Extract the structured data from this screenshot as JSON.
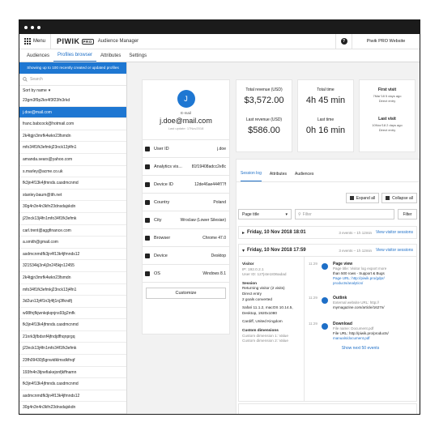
{
  "app": {
    "menu_label": "Menu",
    "logo": "PIWIK",
    "logo_badge": "PRO",
    "app_name": "Audience Manager",
    "website": "Piwik PRO Website"
  },
  "nav": {
    "tabs": [
      "Audiences",
      "Profiles browser",
      "Attributes",
      "Settings"
    ],
    "active": 1
  },
  "sidebar": {
    "banner": "Showing up to 100 recently created or updated profiles",
    "search_placeholder": "Search",
    "sort_label": "Sort by name",
    "items": [
      "23gm3f9p2kn4f3f23fn3rkd",
      "j.doe@mail.com",
      "franc.babcock@hotmail.com",
      "2k4tgjn3mrfk4wkn23fsmdn",
      "mfo34f1fk3efmkj23nck13j4fn1",
      "amanda.sears@yahoo.com",
      "s.marley@acme.co.uk",
      "fk3jn4f13k4jfmnds.casdmcnmd",
      "stanley.baum@tth.net",
      "30g4n3n4n3kfn23dnsdajskdn",
      "j23nck13j4fn1mfo34f1fk3efmk",
      "carl.trent@aggfinance.com",
      "a.smith@gmail.com",
      "asdmcnmdfk3jn4f13k4jfmnds12",
      "321534kj3n4j3n245kjn12455",
      "2k4tgjn3mrfk4wkn23fsmdn",
      "mfo34f1fk3efmkj23nck13j4fn1",
      "3d2un13j4f1n3j4fj1nj3fkndfj",
      "w98fnjfkjwnkqkqnjns93g2mfk",
      "fk3jn4f13k4jfmnds.casdmcnmd",
      "21nrk3jfbdsnf4jfndjdfhqnprgq",
      "j23nck13j4fn1mfo34f1fk3efmk",
      "23fh09430j5gnwidklmsdkfnqf",
      "193fn4n3tjnefiakejonfjkffnamn",
      "fk3jn4f13k4jfmnds.casdmcnmd",
      "asdmcnmdfk3jn4f13k4jfmnds12",
      "30g4n3n4n3kfn23dnsdajskdn"
    ],
    "selected": 1
  },
  "profile": {
    "avatar_letter": "J",
    "email_label": "E-mail",
    "email": "j.doe@mail.com",
    "last_update": "Last update: 17Nov2018",
    "attributes": [
      {
        "key": "User ID",
        "value": "j.doe",
        "icon": "user-id-icon"
      },
      {
        "key": "Analytics vis...",
        "value": "81f19408adcc2e8c",
        "icon": "analytics-icon"
      },
      {
        "key": "Device ID",
        "value": "12de46ae444f77f",
        "icon": "device-id-icon"
      },
      {
        "key": "Country",
        "value": "Poland",
        "icon": "flag-icon"
      },
      {
        "key": "City",
        "value": "Wroclaw (Lower Silesian)",
        "icon": "building-icon"
      },
      {
        "key": "Browser",
        "value": "Chrome 47.0",
        "icon": "browser-icon"
      },
      {
        "key": "Device",
        "value": "Desktop",
        "icon": "desktop-icon"
      },
      {
        "key": "OS",
        "value": "Windows 8.1",
        "icon": "os-icon"
      }
    ],
    "customize": "Customize"
  },
  "stats": {
    "revenue": {
      "top_label": "Total revenue (USD)",
      "top_value": "$3,572.00",
      "bottom_label": "Last revenue (USD)",
      "bottom_value": "$586.00"
    },
    "time": {
      "top_label": "Total time",
      "top_value": "4h 45 min",
      "bottom_label": "Last time",
      "bottom_value": "0h 16 min"
    },
    "visits": {
      "top_label": "First visit",
      "top_date": "7Mar'18 5 days ago",
      "top_source": "Direct entry",
      "bottom_label": "Last visit",
      "bottom_date": "10Nov'18 2 days ago",
      "bottom_source": "Direct entry"
    }
  },
  "sessions": {
    "tabs": [
      "Session log",
      "Attributes",
      "Audiences"
    ],
    "expand": "Expand all",
    "collapse": "Collapse all",
    "select": "Page title",
    "filter_placeholder": "Filter",
    "filter_btn": "Filter",
    "s1": {
      "date": "Friday, 10 Nov 2018 18:01",
      "meta": "3 events – 1h 12min",
      "link": "View visitor sessions"
    },
    "s2": {
      "date": "Friday, 10 Nov 2018 17:59",
      "meta": "3 events – 1h 12min",
      "link": "View visitor sessions"
    },
    "visitor": {
      "h": "Visitor",
      "ip": "IP: 192.0.2.1",
      "uid": "User ID: 127jste1836adad",
      "session_h": "Session",
      "returning": "Returning visitor (2 visits)",
      "direct": "Direct entry",
      "goals": "2 goals converted",
      "browser": "Safari 11.1.2, macOS 10.14.5,",
      "desktop": "Desktop, 1920x1080",
      "city": "Cardiff, United Kingdom",
      "cd_h": "Custom dimensions",
      "cd1": "Custom dimension 1: Value",
      "cd2": "Custom dimension 2: Value"
    },
    "events": [
      {
        "time": "11:29",
        "title": "Page view",
        "l1": "Page title: Visitor log export more",
        "l2": "than 500 rows - Support & Bugs",
        "l3": "Page URL: http://piwik.pro/gdpr/",
        "l4": "products/analytics/"
      },
      {
        "time": "11:29",
        "title": "Outlink",
        "l1": "External website URL: http://",
        "l2": "mymagazine.com/article/1627n/",
        "l3": "",
        "l4": ""
      },
      {
        "time": "11:29",
        "title": "Download",
        "l1": "File name: Document.pdf",
        "l2": "File URL: http://piwik.pro/products/",
        "l3": "manuals/document.pdf",
        "l4": ""
      }
    ],
    "show_next": "Show next 50 events"
  }
}
